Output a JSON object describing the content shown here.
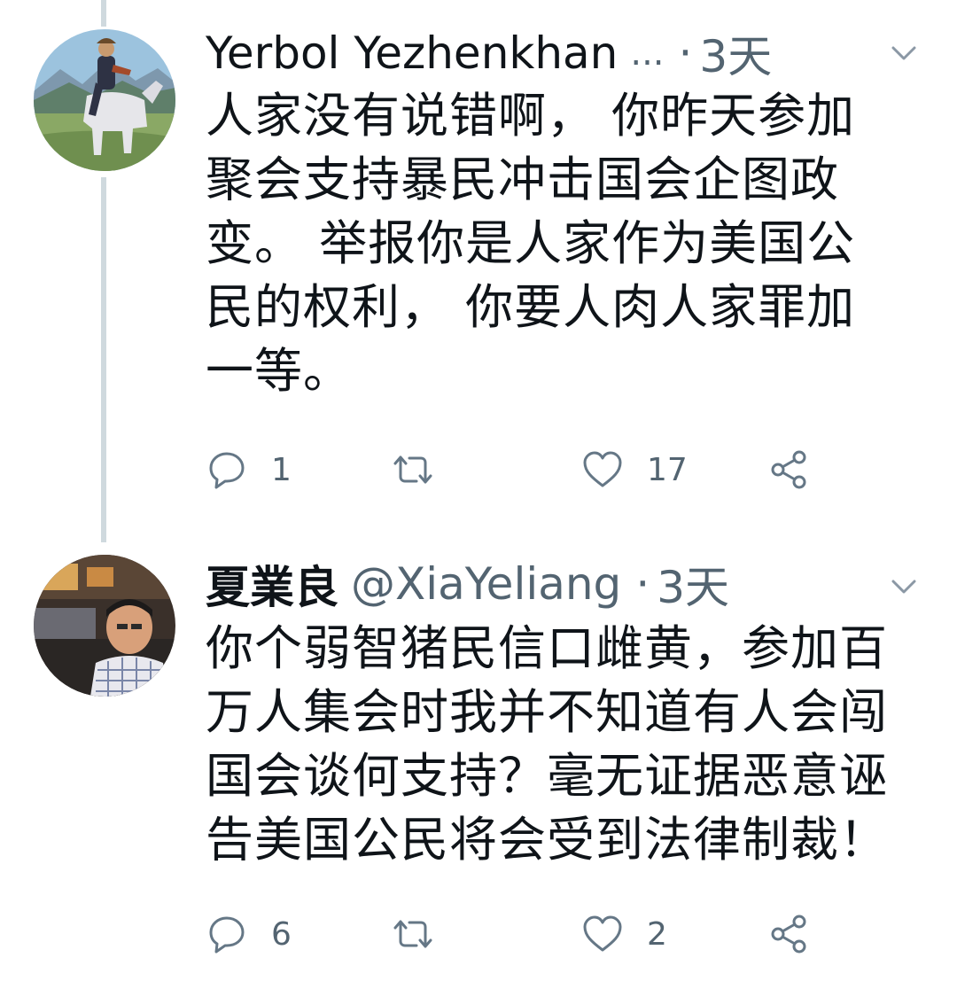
{
  "tweets": [
    {
      "display_name": "Yerbol Yezhenkhan",
      "handle": "",
      "truncation": "...",
      "separator": "·",
      "time": "3天",
      "text_lines": [
        "人家没有说错啊， 你昨天参加",
        "聚会支持暴民冲击国会企图政",
        "变。 举报你是人家作为美国公",
        "民的权利， 你要人肉人家罪加",
        "一等。"
      ],
      "reply_count": "1",
      "retweet_count": "",
      "like_count": "17",
      "icons": {
        "reply": "reply-icon",
        "retweet": "retweet-icon",
        "like": "like-icon",
        "share": "share-icon",
        "menu": "chevron-down-icon"
      }
    },
    {
      "display_name": "夏業良",
      "handle": "@XiaYeliang",
      "separator": "·",
      "time": "3天",
      "text_lines": [
        "你个弱智猪民信口雌黄，参加百",
        "万人集会时我并不知道有人会闯",
        "国会谈何支持？毫无证据恶意诬",
        "告美国公民将会受到法律制裁！"
      ],
      "reply_count": "6",
      "retweet_count": "",
      "like_count": "2",
      "icons": {
        "reply": "reply-icon",
        "retweet": "retweet-icon",
        "like": "like-icon",
        "share": "share-icon",
        "menu": "chevron-down-icon"
      }
    }
  ],
  "colors": {
    "text_primary": "#0f1419",
    "text_secondary": "#536471",
    "thread_line": "#cfd9de",
    "background": "#ffffff"
  }
}
